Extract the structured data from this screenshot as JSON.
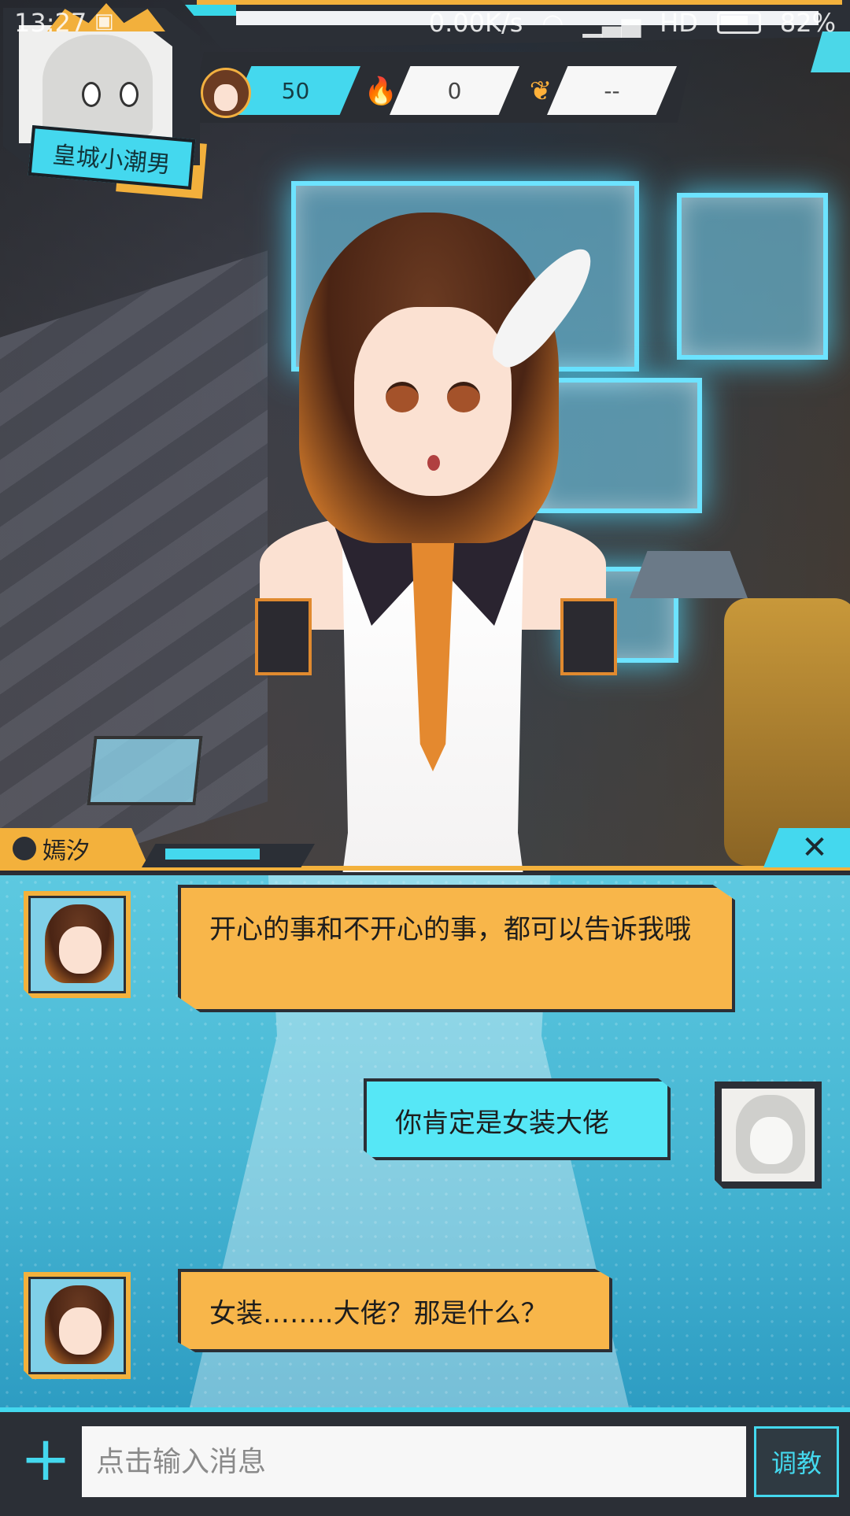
{
  "status_bar": {
    "time": "13:27",
    "notification_icon": "gallery-icon",
    "net_speed": "0.00K/s",
    "network_label": "HD",
    "battery": "82%"
  },
  "player": {
    "name": "皇城小潮男"
  },
  "stats": {
    "favor": "50",
    "fire": "0",
    "wing": "--"
  },
  "speaker": {
    "name": "嫣汐",
    "close_label": "✕"
  },
  "messages": [
    {
      "from": "bot",
      "text": "开心的事和不开心的事，都可以告诉我哦"
    },
    {
      "from": "user",
      "text": "你肯定是女装大佬"
    },
    {
      "from": "bot",
      "text": "女装……..大佬？那是什么？"
    }
  ],
  "input_bar": {
    "plus_label": "+",
    "placeholder": "点击输入消息",
    "train_label": "调教"
  },
  "colors": {
    "accent_orange": "#f3b13c",
    "accent_cyan": "#44d8ee",
    "dark_frame": "#2b2f36",
    "bot_bubble": "#f8b64a",
    "user_bubble": "#56e7f6"
  }
}
